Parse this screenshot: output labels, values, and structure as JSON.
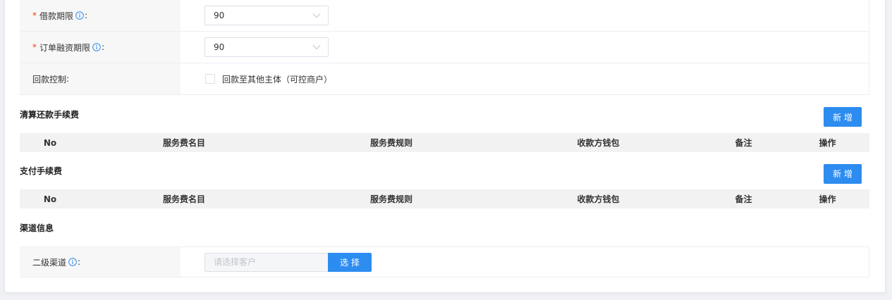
{
  "colors": {
    "primary": "#2d8cf0",
    "required": "#ed4014",
    "page_bg": "#eff1f4",
    "label_bg": "#f7f7f7",
    "table_header_bg": "#f2f2f2"
  },
  "icons": {
    "info": "info-icon",
    "dropdown": "chevron-down-icon",
    "checkbox": "checkbox-unchecked-icon"
  },
  "form": {
    "required_mark": "*",
    "colon": ":",
    "rows": [
      {
        "label": "借款期限",
        "required": true,
        "has_info": true,
        "value": "90"
      },
      {
        "label": "订单融资期限",
        "required": true,
        "has_info": true,
        "value": "90"
      },
      {
        "label": "回款控制",
        "required": false,
        "has_info": false,
        "checkbox_label": "回款至其他主体（可控商户）",
        "checked": false
      }
    ]
  },
  "clearing_fee": {
    "title": "清算还款手续费",
    "add_button": "新 增",
    "columns": [
      "No",
      "服务费名目",
      "服务费规则",
      "收款方钱包",
      "备注",
      "操作"
    ]
  },
  "payment_fee": {
    "title": "支付手续费",
    "add_button": "新 增",
    "columns": [
      "No",
      "服务费名目",
      "服务费规则",
      "收款方钱包",
      "备注",
      "操作"
    ]
  },
  "channel": {
    "title": "渠道信息",
    "secondary_channel": {
      "label": "二级渠道",
      "has_info": true,
      "placeholder": "请选择客户",
      "select_button": "选 择"
    }
  }
}
